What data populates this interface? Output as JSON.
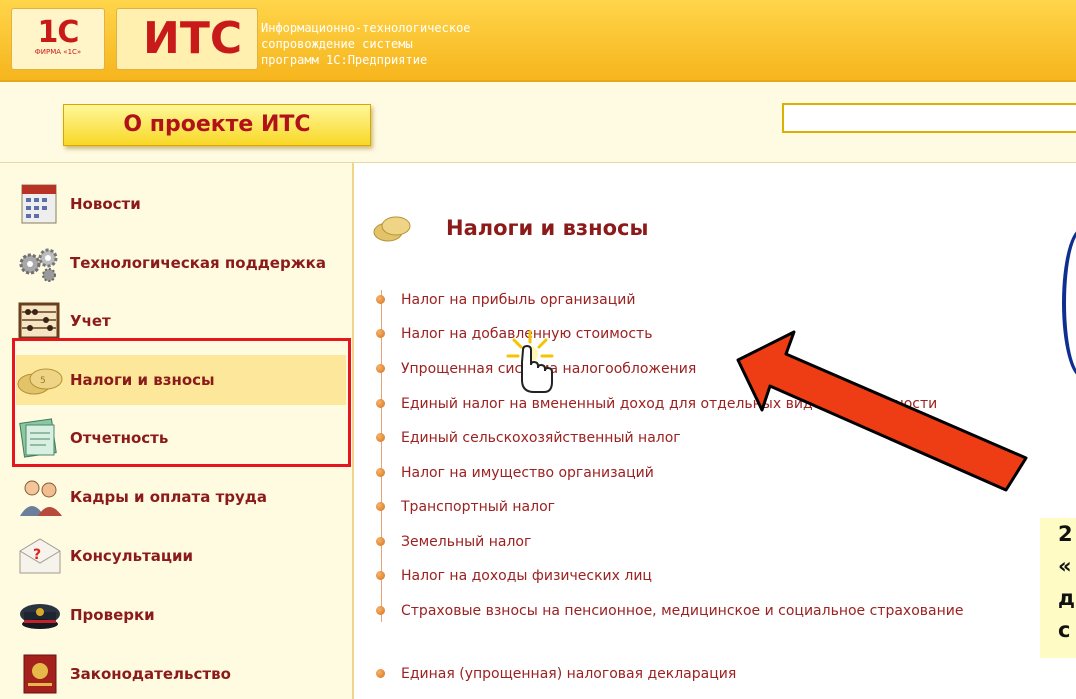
{
  "header": {
    "logo_1c_text": "1С",
    "logo_1c_sub": "ФИРМА «1С»",
    "logo_its_text": "ИТС",
    "tagline": [
      "Информационно-технологическое",
      "сопровождение системы",
      "программ 1С:Предприятие"
    ]
  },
  "subheader": {
    "about_label": "О проекте ИТС",
    "search_value": ""
  },
  "sidebar": {
    "items": [
      {
        "label": "Новости",
        "icon": "calendar-icon"
      },
      {
        "label": "Технологическая поддержка",
        "icon": "gears-icon"
      },
      {
        "label": "Учет",
        "icon": "abacus-icon"
      },
      {
        "label": "Налоги и взносы",
        "icon": "coins-icon"
      },
      {
        "label": "Отчетность",
        "icon": "report-icon"
      },
      {
        "label": "Кадры и оплата труда",
        "icon": "people-icon"
      },
      {
        "label": "Консультации",
        "icon": "question-envelope-icon"
      },
      {
        "label": "Проверки",
        "icon": "inspector-cap-icon"
      },
      {
        "label": "Законодательство",
        "icon": "law-book-icon"
      }
    ]
  },
  "main": {
    "title": "Налоги и взносы",
    "links": [
      "Налог на прибыль организаций",
      "Налог на добавленную стоимость",
      "Упрощенная система налогообложения",
      "Единый налог на вмененный доход для отдельных видов деятельности",
      "Единый сельскохозяйственный налог",
      "Налог на имущество организаций",
      "Транспортный налог",
      "Земельный налог",
      "Налог на доходы физических лиц",
      "Страховые взносы на пенсионное, медицинское и социальное страхование",
      "Единая (упрощенная) налоговая декларация"
    ]
  },
  "right_note": {
    "lines": [
      "2",
      "«",
      "д",
      "с"
    ]
  },
  "colors": {
    "header_bg": "#f6b51d",
    "accent_red": "#c91a1a",
    "link_color": "#9c2121",
    "highlight_box": "#e6161e",
    "arrow": "#ee3d14"
  }
}
